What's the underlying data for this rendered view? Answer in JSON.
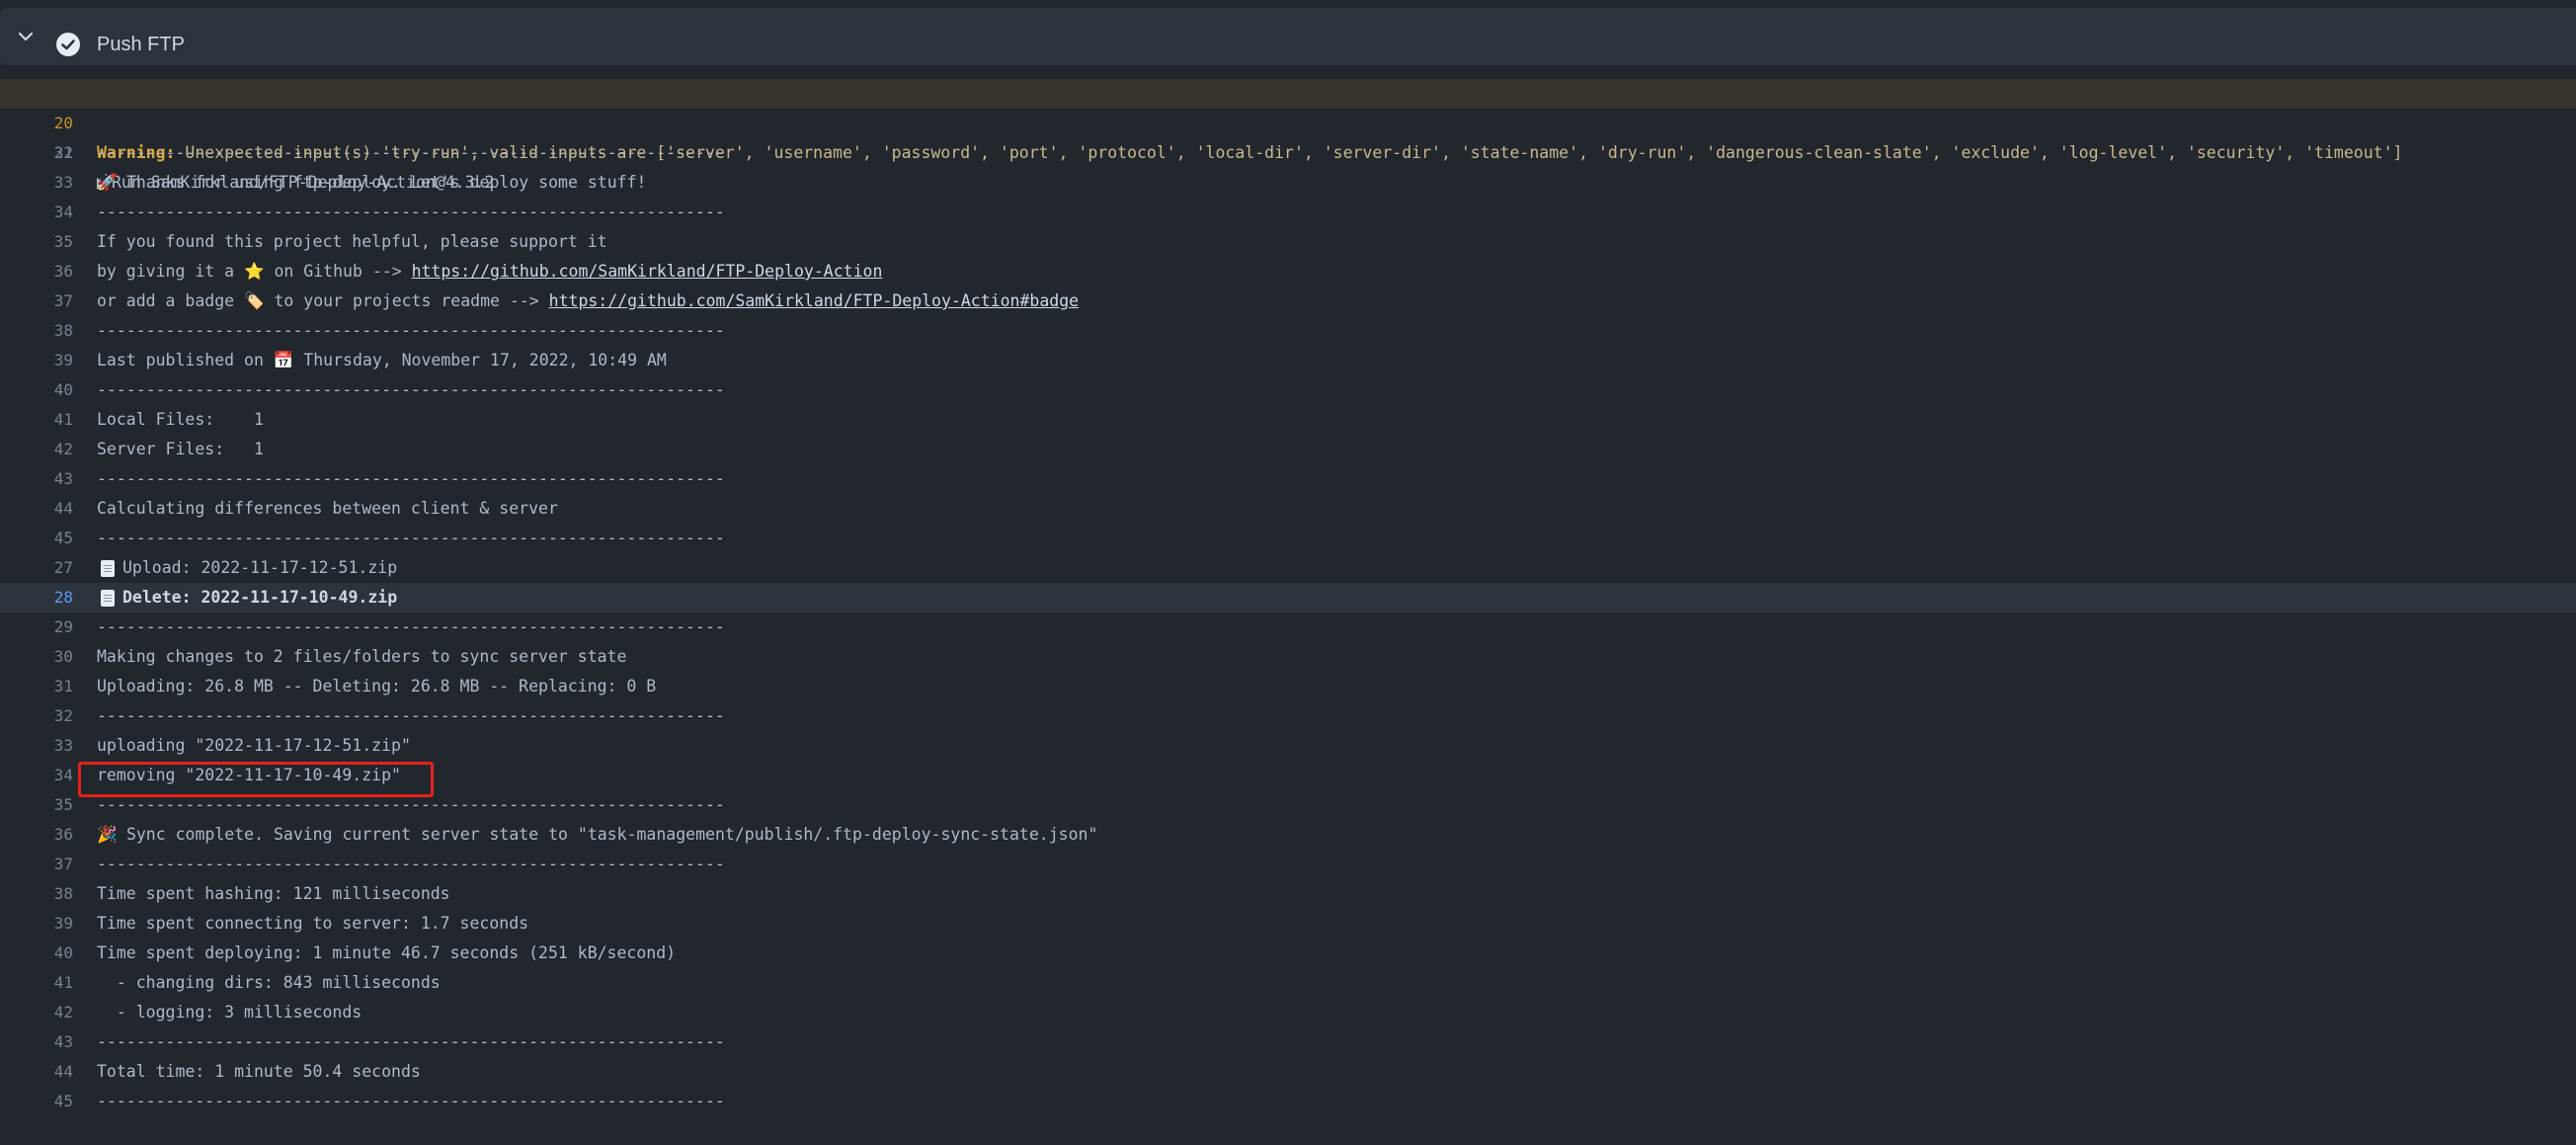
{
  "step": {
    "title": "Push FTP"
  },
  "warning": {
    "line": "20",
    "label": "Warning:",
    "text": " Unexpected input(s) 'try-run', valid inputs are ['server', 'username', 'password', 'port', 'protocol', 'local-dir', 'server-dir', 'state-name', 'dry-run', 'dangerous-clean-slate', 'exclude', 'log-level', 'security', 'timeout']"
  },
  "run": {
    "line": "21",
    "text": "Run SamKirkland/FTP-Deploy-Action@4.3.2"
  },
  "rows": [
    {
      "ln": "32",
      "text": "----------------------------------------------------------------"
    },
    {
      "ln": "33",
      "emoji": "🚀",
      "text": "Thanks for using ftp-deploy. Let's deploy some stuff!"
    },
    {
      "ln": "34",
      "text": "----------------------------------------------------------------"
    },
    {
      "ln": "35",
      "text": "If you found this project helpful, please support it"
    },
    {
      "ln": "36",
      "text": "by giving it a ⭐ on Github --> ",
      "link": "https://github.com/SamKirkland/FTP-Deploy-Action"
    },
    {
      "ln": "37",
      "text": "or add a badge 🏷️ to your projects readme --> ",
      "link": "https://github.com/SamKirkland/FTP-Deploy-Action#badge"
    },
    {
      "ln": "38",
      "text": "----------------------------------------------------------------"
    },
    {
      "ln": "39",
      "text": "Last published on 📅 Thursday, November 17, 2022, 10:49 AM"
    },
    {
      "ln": "40",
      "text": "----------------------------------------------------------------"
    },
    {
      "ln": "41",
      "text": "Local Files:    1"
    },
    {
      "ln": "42",
      "text": "Server Files:   1"
    },
    {
      "ln": "43",
      "text": "----------------------------------------------------------------"
    },
    {
      "ln": "44",
      "text": "Calculating differences between client & server"
    },
    {
      "ln": "45",
      "text": "----------------------------------------------------------------"
    },
    {
      "ln": "27",
      "doc": true,
      "text": "Upload: 2022-11-17-12-51.zip"
    },
    {
      "ln": "28",
      "doc": true,
      "bold": true,
      "selected": true,
      "text": "Delete: 2022-11-17-10-49.zip"
    },
    {
      "ln": "29",
      "text": "----------------------------------------------------------------"
    },
    {
      "ln": "30",
      "text": "Making changes to 2 files/folders to sync server state"
    },
    {
      "ln": "31",
      "text": "Uploading: 26.8 MB -- Deleting: 26.8 MB -- Replacing: 0 B"
    },
    {
      "ln": "32",
      "text": "----------------------------------------------------------------"
    },
    {
      "ln": "33",
      "text": "uploading \"2022-11-17-12-51.zip\""
    },
    {
      "ln": "34",
      "text": "removing \"2022-11-17-10-49.zip\""
    },
    {
      "ln": "35",
      "text": "----------------------------------------------------------------"
    },
    {
      "ln": "36",
      "emoji": "🎉",
      "text": "Sync complete. Saving current server state to \"task-management/publish/.ftp-deploy-sync-state.json\""
    },
    {
      "ln": "37",
      "text": "----------------------------------------------------------------"
    },
    {
      "ln": "38",
      "text": "Time spent hashing: 121 milliseconds"
    },
    {
      "ln": "39",
      "text": "Time spent connecting to server: 1.7 seconds"
    },
    {
      "ln": "40",
      "text": "Time spent deploying: 1 minute 46.7 seconds (251 kB/second)"
    },
    {
      "ln": "41",
      "text": "  - changing dirs: 843 milliseconds"
    },
    {
      "ln": "42",
      "text": "  - logging: 3 milliseconds"
    },
    {
      "ln": "43",
      "text": "----------------------------------------------------------------"
    },
    {
      "ln": "44",
      "text": "Total time: 1 minute 50.4 seconds"
    },
    {
      "ln": "45",
      "text": "----------------------------------------------------------------"
    }
  ],
  "colors": {
    "background": "#22272e",
    "header": "#2d333b",
    "warning_bg": "#37332a",
    "highlight_border": "#e5221b"
  }
}
